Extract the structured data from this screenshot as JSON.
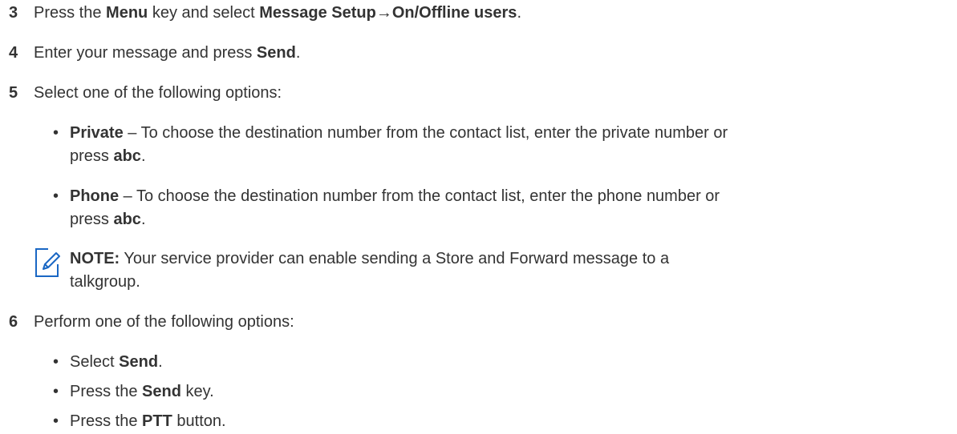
{
  "steps": [
    {
      "number": "3",
      "parts": {
        "a": "Press the ",
        "b": "Menu",
        "c": " key and select ",
        "d": "Message Setup→On/Offline users",
        "e": "."
      }
    },
    {
      "number": "4",
      "parts": {
        "a": "Enter your message and press ",
        "b": "Send",
        "c": "."
      }
    },
    {
      "number": "5",
      "text": "Select one of the following options:",
      "options": [
        {
          "bullet": "•",
          "label": "Private",
          "text_line1": " – To choose the destination number from the contact list, enter the private number or",
          "line2_prefix": "press ",
          "line2_bold": "abc",
          "line2_suffix": "."
        },
        {
          "bullet": "•",
          "label": "Phone",
          "text_line1": " – To choose the destination number from the contact list, enter the phone number or",
          "line2_prefix": "press ",
          "line2_bold": "abc",
          "line2_suffix": "."
        }
      ],
      "note": {
        "icon": "pencil-note-icon",
        "label": "NOTE:",
        "text_line1": " Your service provider can enable sending a Store and Forward message to a",
        "text_line2": "talkgroup."
      }
    },
    {
      "number": "6",
      "text": "Perform one of the following options:",
      "options": [
        {
          "bullet": "•",
          "prefix": "Select ",
          "bold": "Send",
          "suffix": "."
        },
        {
          "bullet": "•",
          "prefix": "Press the ",
          "bold": "Send",
          "suffix": " key."
        },
        {
          "bullet": "•",
          "prefix": "Press the ",
          "bold": "PTT",
          "suffix": " button."
        }
      ]
    }
  ],
  "colors": {
    "text": "#333333",
    "icon": "#1a67c4"
  }
}
